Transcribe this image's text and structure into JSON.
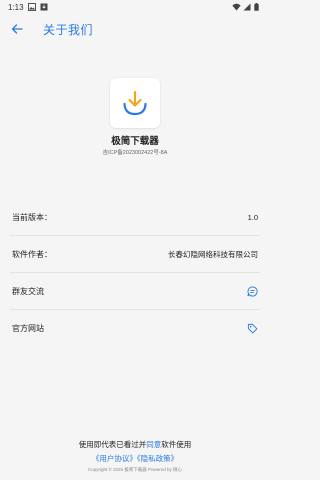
{
  "status_bar": {
    "time": "1:13"
  },
  "app_bar": {
    "title": "关于我们"
  },
  "app": {
    "name": "极简下载器",
    "icp": "吉ICP备2023002422号-8A"
  },
  "info": {
    "version_label": "当前版本：",
    "version_value": "1.0",
    "author_label": "软件作者：",
    "author_value": "长春幻隐网络科技有限公司",
    "group_label": "群友交流",
    "website_label": "官方网站"
  },
  "footer": {
    "consent_prefix": "使用即代表已看过并",
    "consent_link": "同意",
    "consent_suffix": "软件使用",
    "user_agreement": "《用户协议》",
    "privacy_policy": "《隐私政策》",
    "copyright": "Copyright © 2025 极简下载器 Powered by 微心"
  },
  "colors": {
    "accent": "#2a7ae2",
    "logo_orange": "#f2a71b",
    "logo_blue": "#2a7ae2"
  },
  "icons": {
    "back": "arrow-left-icon",
    "group": "chat-bubble-icon",
    "website": "tag-icon"
  }
}
